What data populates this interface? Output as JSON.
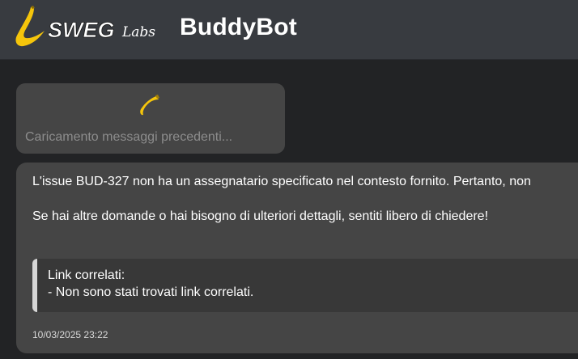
{
  "header": {
    "logo": {
      "brand": "SWEG",
      "suffix": "Labs",
      "icon": "banana-icon"
    },
    "title": "BuddyBot"
  },
  "chat": {
    "loading": {
      "icon": "banana-loading-icon",
      "text": "Caricamento messaggi precedenti..."
    },
    "message": {
      "paragraphs": [
        "L'issue BUD-327 non ha un assegnatario specificato nel contesto fornito. Pertanto, non",
        "Se hai altre domande o hai bisogno di ulteriori dettagli, sentiti libero di chiedere!"
      ],
      "related_links": {
        "title": "Link correlati:",
        "items": [
          "- Non sono stati trovati link correlati."
        ]
      },
      "timestamp": "10/03/2025 23:22"
    }
  },
  "colors": {
    "header_bg": "#383b40",
    "page_bg": "#222325",
    "card_bg": "#454545",
    "quote_bg": "#383838",
    "accent_yellow": "#f5c50b"
  }
}
